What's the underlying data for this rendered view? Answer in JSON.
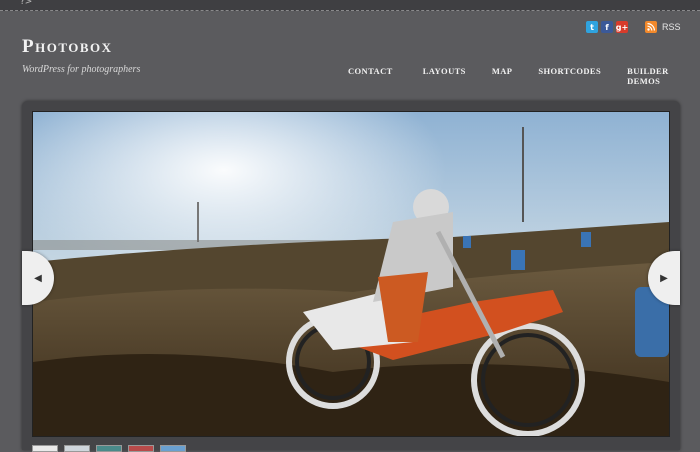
{
  "topbar": {
    "mark": "?>"
  },
  "brand": {
    "title": "Photobox",
    "tagline": "WordPress for photographers"
  },
  "social": {
    "twitter_glyph": "t",
    "facebook_glyph": "f",
    "google_glyph": "g+",
    "rss_label": "RSS",
    "colors": {
      "twitter": "#2fa3df",
      "facebook": "#3b5998",
      "google": "#d83b2b",
      "rss": "#f2892b"
    }
  },
  "nav": {
    "contact": "CONTACT",
    "layouts": "LAYOUTS",
    "map": "MAP",
    "shortcodes": "SHORTCODES",
    "builder_demos": "BUILDER DEMOS"
  },
  "slider": {
    "prev_glyph": "◀",
    "next_glyph": "▶",
    "thumbnail_count": 5
  }
}
